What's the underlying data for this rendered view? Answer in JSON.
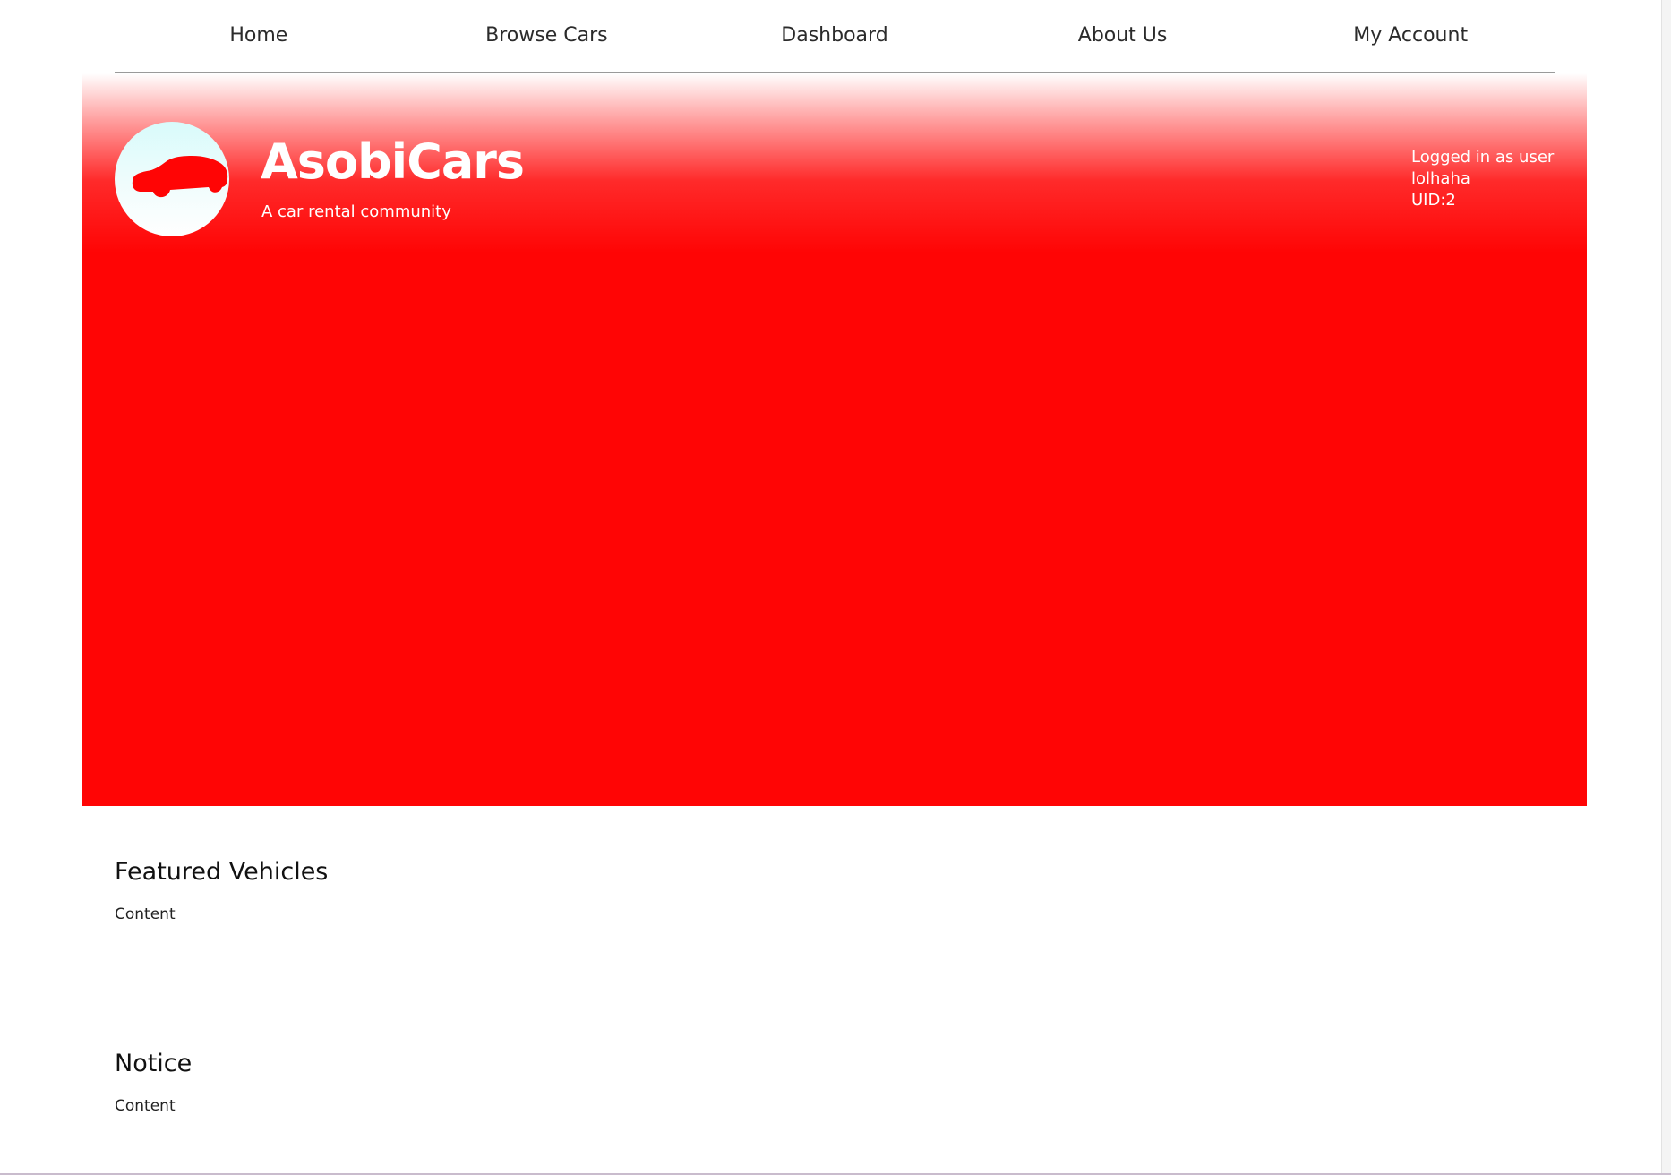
{
  "nav": {
    "items": [
      {
        "label": "Home"
      },
      {
        "label": "Browse Cars"
      },
      {
        "label": "Dashboard"
      },
      {
        "label": "About Us"
      },
      {
        "label": "My Account"
      }
    ]
  },
  "hero": {
    "brand_title": "AsobiCars",
    "tagline": "A car rental community",
    "logo_icon": "car-icon",
    "user": {
      "logged_in_label": "Logged in as user",
      "username": "lolhaha",
      "uid": "UID:2"
    },
    "colors": {
      "primary_red": "#ff0505",
      "logo_bg": "#d8fbfb"
    }
  },
  "sections": {
    "featured": {
      "title": "Featured Vehicles",
      "content": "Content"
    },
    "notice": {
      "title": "Notice",
      "content": "Content"
    }
  }
}
